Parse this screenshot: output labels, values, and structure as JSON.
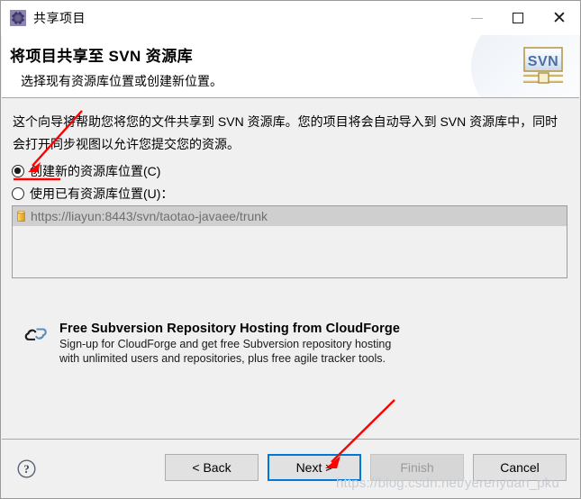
{
  "window": {
    "title": "共享项目",
    "icon": "gear-icon",
    "controls": {
      "minimize": "—",
      "maximize": "□",
      "close": "✕"
    }
  },
  "header": {
    "title": "将项目共享至 SVN 资源库",
    "subtitle": "选择现有资源库位置或创建新位置。",
    "logo_text": "SVN"
  },
  "body": {
    "intro": "这个向导将帮助您将您的文件共享到 SVN 资源库。您的项目将会自动导入到 SVN 资源库中，同时会打开同步视图以允许您提交您的资源。",
    "radio_new_label": "创建新的资源库位置(C)",
    "radio_existing_label": "使用已有资源库位置(U)：",
    "selected_option": "new",
    "repository_list": [
      {
        "url": "https://liayun:8443/svn/taotao-javaee/trunk",
        "icon": "database-icon",
        "selected": true,
        "disabled": true
      }
    ]
  },
  "cloudforge": {
    "icon": "cloud-icon",
    "title": "Free Subversion Repository Hosting from CloudForge",
    "desc_line1": "Sign-up for CloudForge and get free Subversion repository hosting",
    "desc_line2": "with unlimited users and repositories, plus free agile tracker tools."
  },
  "footer": {
    "help_icon": "help-icon",
    "buttons": [
      {
        "label": "< Back",
        "state": "enabled"
      },
      {
        "label": "Next >",
        "state": "focused"
      },
      {
        "label": "Finish",
        "state": "disabled"
      },
      {
        "label": "Cancel",
        "state": "enabled"
      }
    ]
  },
  "annotations": {
    "watermark": "https://blog.csdn.net/yerenyuan_pku",
    "arrow_color": "#ff0000",
    "underline_color": "#ff0000"
  },
  "colors": {
    "dialog_bg": "#f0f0f0",
    "header_bg": "#ffffff",
    "focus_blue": "#0078d7",
    "list_selected_bg": "#cfcfcf",
    "disabled_text": "#9a9a9a"
  }
}
